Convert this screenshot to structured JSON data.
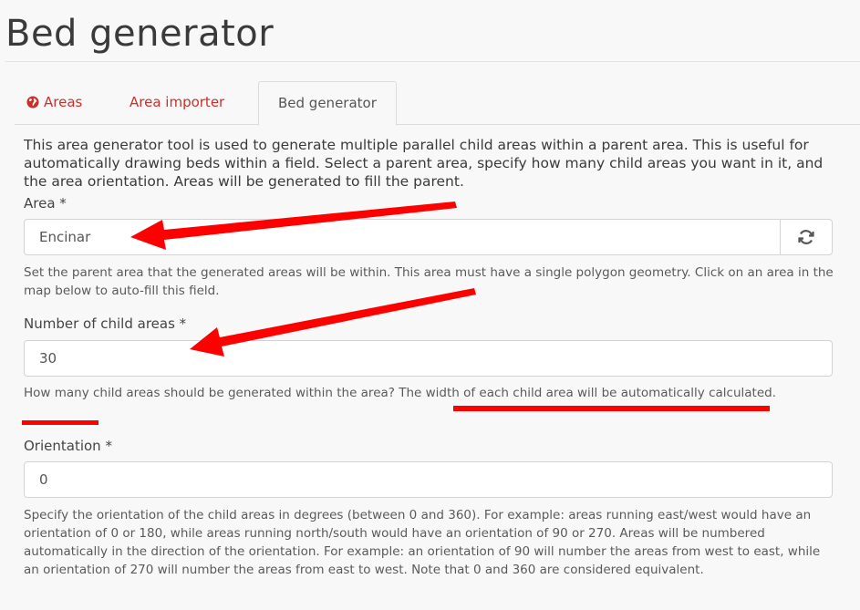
{
  "page": {
    "title": "Bed generator"
  },
  "tabs": [
    {
      "label": "Areas",
      "icon": "globe-icon"
    },
    {
      "label": "Area importer"
    },
    {
      "label": "Bed generator",
      "active": true
    }
  ],
  "intro": "This area generator tool is used to generate multiple parallel child areas within a parent area. This is useful for automatically drawing beds within a field. Select a parent area, specify how many child areas you want in it, and the area orientation. Areas will be generated to fill the parent.",
  "form": {
    "area": {
      "label": "Area *",
      "value": "Encinar",
      "help": "Set the parent area that the generated areas will be within. This area must have a single polygon geometry. Click on an area in the map below to auto-fill this field."
    },
    "child_areas": {
      "label": "Number of child areas *",
      "value": "30",
      "help": "How many child areas should be generated within the area? The width of each child area will be automatically calculated."
    },
    "orientation": {
      "label": "Orientation *",
      "value": "0",
      "help": "Specify the orientation of the child areas in degrees (between 0 and 360). For example: areas running east/west would have an orientation of 0 or 180, while areas running north/south would have an orientation of 90 or 270. Areas will be numbered automatically in the direction of the orientation. For example: an orientation of 90 will number the areas from west to east, while an orientation of 270 will number the areas from east to west. Note that 0 and 360 are considered equivalent."
    }
  },
  "colors": {
    "annotation": "#ff0000",
    "tab_link": "#c9302c"
  }
}
